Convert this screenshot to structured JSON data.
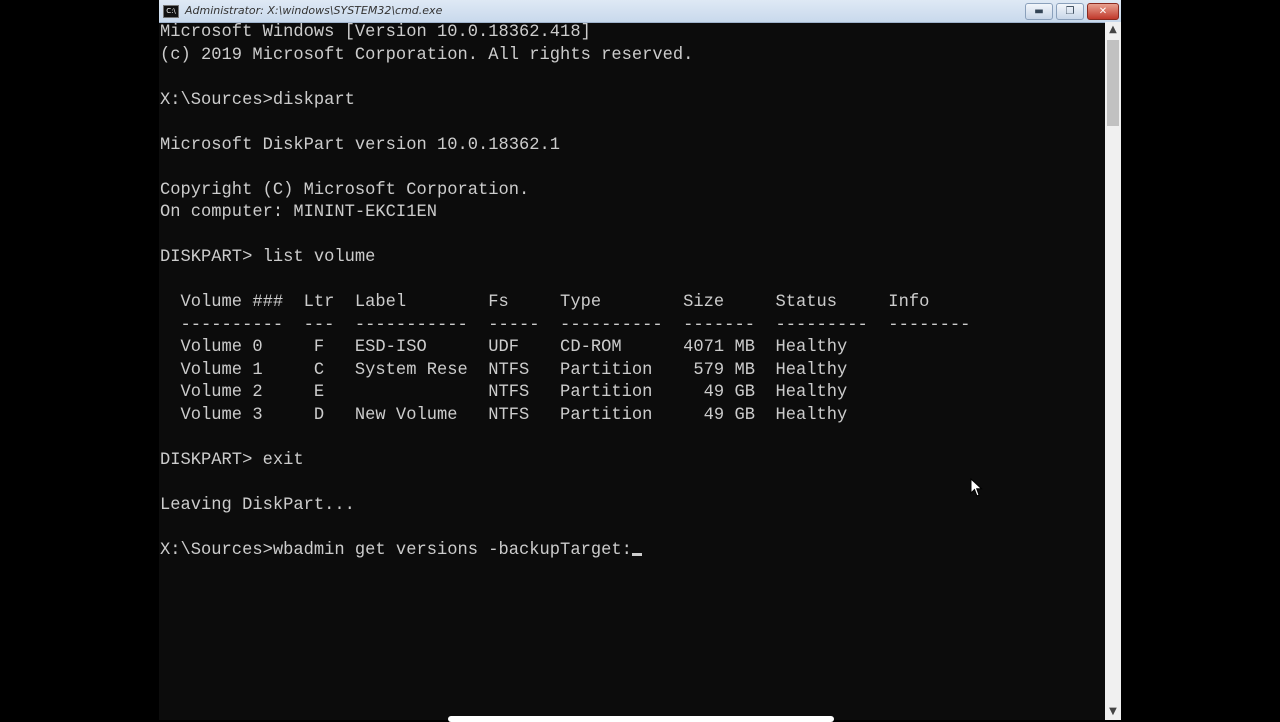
{
  "window": {
    "title": "Administrator: X:\\windows\\SYSTEM32\\cmd.exe",
    "icon_label": "C:\\",
    "minimize": "▬",
    "restore": "❐",
    "close": "✕"
  },
  "console": {
    "lines": [
      "Microsoft Windows [Version 10.0.18362.418]",
      "(c) 2019 Microsoft Corporation. All rights reserved.",
      "",
      "X:\\Sources>diskpart",
      "",
      "Microsoft DiskPart version 10.0.18362.1",
      "",
      "Copyright (C) Microsoft Corporation.",
      "On computer: MININT-EKCI1EN",
      "",
      "DISKPART> list volume",
      "",
      "  Volume ###  Ltr  Label        Fs     Type        Size     Status     Info",
      "  ----------  ---  -----------  -----  ----------  -------  ---------  --------",
      "  Volume 0     F   ESD-ISO      UDF    CD-ROM      4071 MB  Healthy",
      "  Volume 1     C   System Rese  NTFS   Partition    579 MB  Healthy",
      "  Volume 2     E                NTFS   Partition     49 GB  Healthy",
      "  Volume 3     D   New Volume   NTFS   Partition     49 GB  Healthy",
      "",
      "DISKPART> exit",
      "",
      "Leaving DiskPart...",
      "",
      "X:\\Sources>wbadmin get versions -backupTarget:"
    ]
  },
  "scrollbar": {
    "up": "▲",
    "down": "▼"
  }
}
